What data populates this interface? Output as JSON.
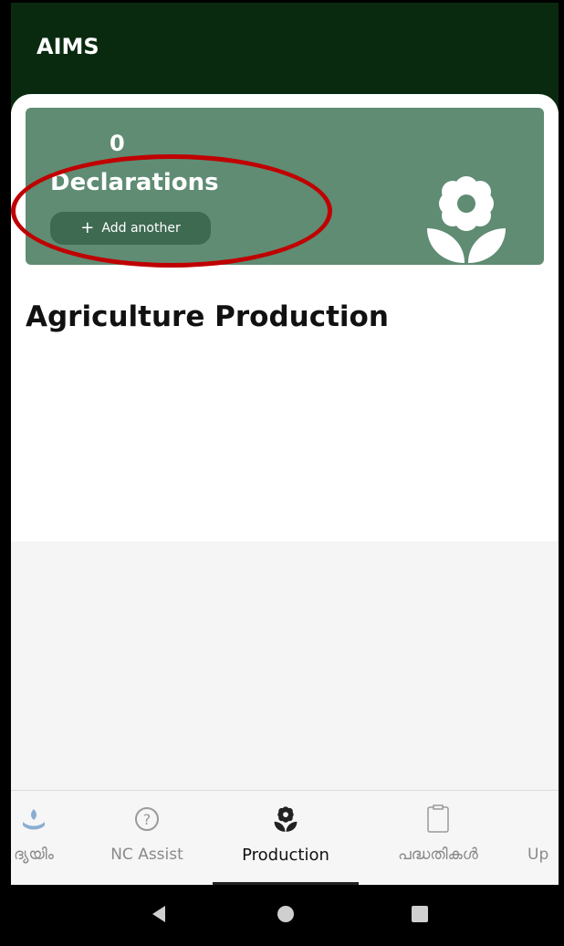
{
  "app": {
    "title": "AIMS"
  },
  "card": {
    "count": "0",
    "label": "Declarations",
    "add_button_label": "Add another",
    "accent_color": "#5f8c73"
  },
  "section": {
    "title": "Agriculture Production"
  },
  "bottom_nav": {
    "items": [
      {
        "label": "ദ്യയിം",
        "icon": "hand-leaf-icon"
      },
      {
        "label": "NC Assist",
        "icon": "help-circle-icon"
      },
      {
        "label": "Production",
        "icon": "flower-icon",
        "active": true
      },
      {
        "label": "പദ്ധതികൾ",
        "icon": "clipboard-icon"
      },
      {
        "label": "Up",
        "icon": ""
      }
    ]
  },
  "system_nav": {
    "buttons": [
      "back-icon",
      "home-icon",
      "recents-icon"
    ]
  }
}
